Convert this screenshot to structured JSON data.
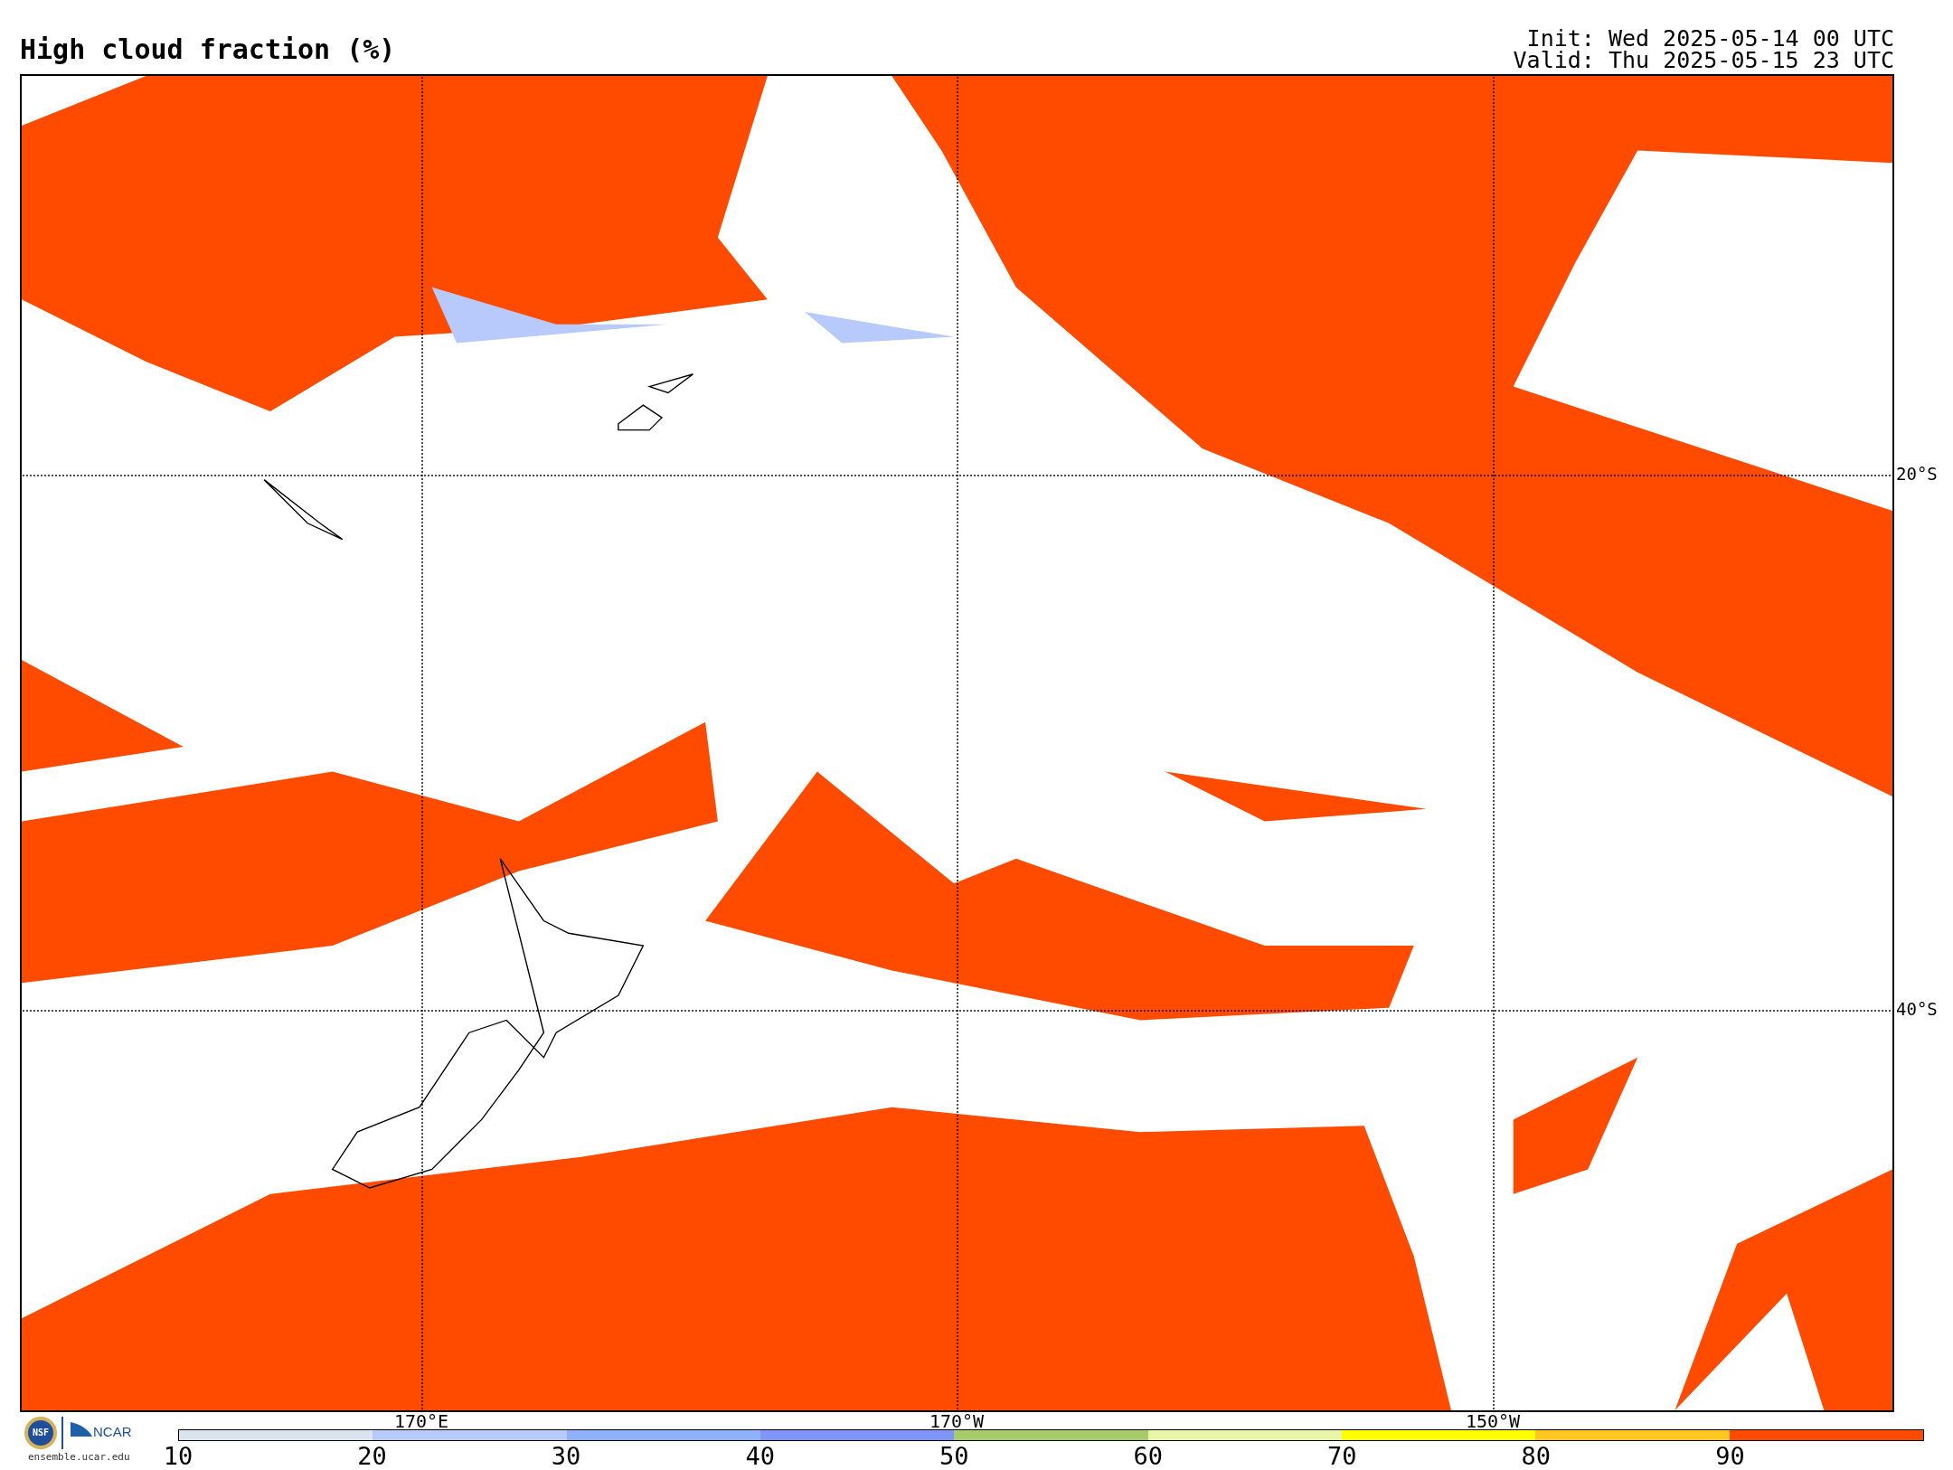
{
  "title": "High cloud fraction (%)",
  "init": "Init: Wed 2025-05-14 00 UTC",
  "valid": "Valid: Thu 2025-05-15 23 UTC",
  "lat_labels": [
    "20°S",
    "40°S"
  ],
  "lon_labels": [
    "170°E",
    "170°W",
    "150°W"
  ],
  "logo": {
    "seal": "NSF",
    "name": "NCAR",
    "url": "ensemble.ucar.edu"
  },
  "colorbar": {
    "segments": [
      {
        "color": "#d9e4ee"
      },
      {
        "color": "#b8c9fb"
      },
      {
        "color": "#8fb0fa"
      },
      {
        "color": "#7f95f7"
      },
      {
        "color": "#a8cc6a"
      },
      {
        "color": "#e9f5a8"
      },
      {
        "color": "#ffff00"
      },
      {
        "color": "#ffc71f"
      },
      {
        "color": "#ff4b00"
      }
    ],
    "ticks": [
      "10",
      "20",
      "30",
      "40",
      "50",
      "60",
      "70",
      "80",
      "90"
    ]
  }
}
